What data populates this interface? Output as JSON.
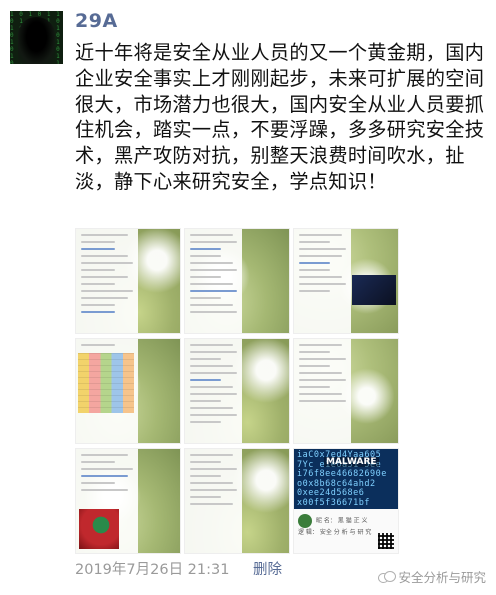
{
  "post": {
    "username": "29A",
    "text": "近十年将是安全从业人员的又一个黄金期，国内企业安全事实上才刚刚起步，未来可扩展的空间很大，市场潜力也很大，国内安全从业人员要抓住机会，踏实一点，不要浮躁，多多研究安全技术，黑产攻防对抗，别整天浪费时间吹水，扯淡，静下心来研究安全，学点知识！",
    "timestamp": "2019年7月26日 21:31",
    "delete_label": "删除",
    "watermark": "安全分析与研究",
    "image_count": 9,
    "malware_tile": {
      "hex": "iaC0x7ed4Yaa605\n7Yc e1e6a31 5ee\ni76f8ee46682690e\no0x8b68c64ahd2\n0xee24d568e6\nx00f5f36671bf",
      "badge": "MALWARE",
      "card_line1": "昵 名：  黑 猫 正 义",
      "card_line2": "逻 辑：  安全 分 析 与 研 究"
    }
  },
  "colors": {
    "name_link": "#576b95",
    "meta_gray": "#9a9a9a",
    "text": "#111111"
  }
}
